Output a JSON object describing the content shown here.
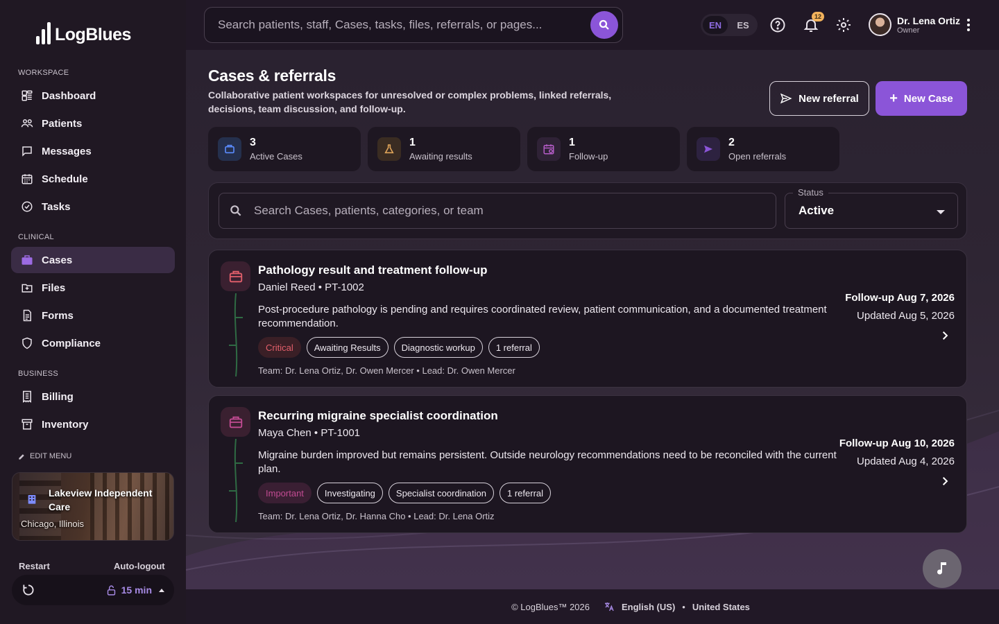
{
  "app": {
    "name": "LogBlues"
  },
  "sidebar": {
    "sections": {
      "workspace": "WORKSPACE",
      "clinical": "CLINICAL",
      "business": "BUSINESS"
    },
    "items": [
      {
        "label": "Dashboard",
        "icon": "dashboard-icon"
      },
      {
        "label": "Patients",
        "icon": "patients-icon"
      },
      {
        "label": "Messages",
        "icon": "messages-icon"
      },
      {
        "label": "Schedule",
        "icon": "schedule-icon"
      },
      {
        "label": "Tasks",
        "icon": "tasks-icon"
      },
      {
        "label": "Cases",
        "icon": "briefcase-icon",
        "active": true
      },
      {
        "label": "Files",
        "icon": "folder-icon"
      },
      {
        "label": "Forms",
        "icon": "document-icon"
      },
      {
        "label": "Compliance",
        "icon": "shield-icon"
      },
      {
        "label": "Billing",
        "icon": "receipt-icon"
      },
      {
        "label": "Inventory",
        "icon": "archive-icon"
      }
    ],
    "edit_menu": "EDIT MENU",
    "clinic": {
      "name": "Lakeview Independent Care",
      "location": "Chicago, Illinois"
    },
    "restart_label": "Restart",
    "autologout_label": "Auto-logout",
    "autologout_value": "15 min"
  },
  "header": {
    "search_placeholder": "Search patients, staff, Cases, tasks, files, referrals, or pages...",
    "languages": [
      "EN",
      "ES"
    ],
    "active_language": "EN",
    "notifications_count": "12",
    "user": {
      "name": "Dr. Lena Ortiz",
      "role": "Owner"
    }
  },
  "page": {
    "title": "Cases & referrals",
    "subtitle": "Collaborative patient workspaces for unresolved or complex problems, linked referrals, decisions, team discussion, and follow-up.",
    "new_referral_label": "New referral",
    "new_case_label": "New Case"
  },
  "stats": [
    {
      "value": "3",
      "label": "Active Cases",
      "icon": "briefcase-icon",
      "color": "#5b8cff"
    },
    {
      "value": "1",
      "label": "Awaiting results",
      "icon": "flask-icon",
      "color": "#e0a55a"
    },
    {
      "value": "1",
      "label": "Follow-up",
      "icon": "calendar-icon",
      "color": "#b45cc7"
    },
    {
      "value": "2",
      "label": "Open referrals",
      "icon": "send-icon",
      "color": "#8b55d8"
    }
  ],
  "filters": {
    "search_placeholder": "Search Cases, patients, categories, or team",
    "status_label": "Status",
    "status_value": "Active"
  },
  "cases": [
    {
      "title": "Pathology result and treatment follow-up",
      "patient": "Daniel Reed",
      "patient_id": "PT-1002",
      "description": "Post-procedure pathology is pending and requires coordinated review, patient communication, and a documented treatment recommendation.",
      "priority": "Critical",
      "tags": [
        "Awaiting Results",
        "Diagnostic workup",
        "1 referral"
      ],
      "team": "Team: Dr. Lena Ortiz, Dr. Owen Mercer",
      "lead": "Lead: Dr. Owen Mercer",
      "followup": "Follow-up Aug 7, 2026",
      "updated": "Updated Aug 5, 2026"
    },
    {
      "title": "Recurring migraine specialist coordination",
      "patient": "Maya Chen",
      "patient_id": "PT-1001",
      "description": "Migraine burden improved but remains persistent. Outside neurology recommendations need to be reconciled with the current plan.",
      "priority": "Important",
      "tags": [
        "Investigating",
        "Specialist coordination",
        "1 referral"
      ],
      "team": "Team: Dr. Lena Ortiz, Dr. Hanna Cho",
      "lead": "Lead: Dr. Lena Ortiz",
      "followup": "Follow-up Aug 10, 2026",
      "updated": "Updated Aug 4, 2026"
    }
  ],
  "footer": {
    "copyright": "© LogBlues™ 2026",
    "language": "English (US)",
    "region": "United States"
  },
  "colors": {
    "accent": "#8b55d8",
    "critical": "#e35f6b",
    "important": "#c24b92"
  }
}
